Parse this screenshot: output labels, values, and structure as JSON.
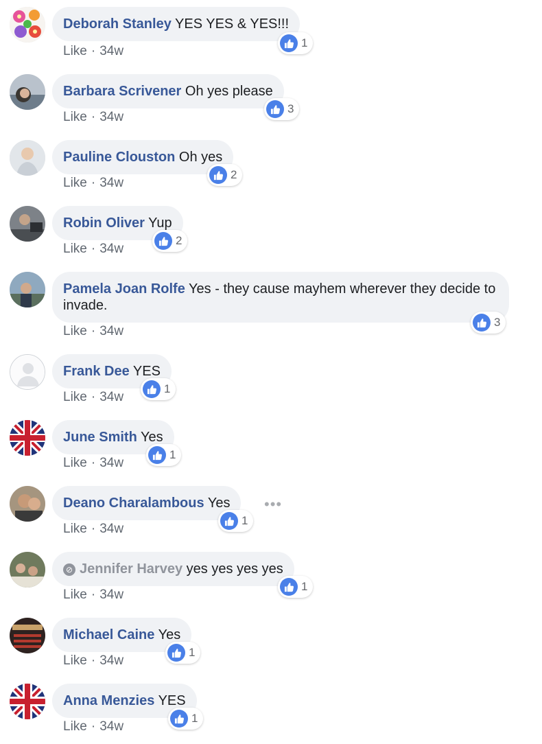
{
  "comments": [
    {
      "name": "Deborah Stanley",
      "text": "YES YES & YES!!!",
      "like_label": "Like",
      "separator": "·",
      "time": "34w",
      "reaction_count": "1"
    },
    {
      "name": "Barbara Scrivener",
      "text": "Oh yes please",
      "like_label": "Like",
      "separator": "·",
      "time": "34w",
      "reaction_count": "3"
    },
    {
      "name": "Pauline Clouston",
      "text": "Oh yes",
      "like_label": "Like",
      "separator": "·",
      "time": "34w",
      "reaction_count": "2"
    },
    {
      "name": "Robin Oliver",
      "text": "Yup",
      "like_label": "Like",
      "separator": "·",
      "time": "34w",
      "reaction_count": "2"
    },
    {
      "name": "Pamela Joan Rolfe",
      "text": "Yes - they cause mayhem wherever they decide to invade.",
      "like_label": "Like",
      "separator": "·",
      "time": "34w",
      "reaction_count": "3"
    },
    {
      "name": "Frank Dee",
      "text": "YES",
      "like_label": "Like",
      "separator": "·",
      "time": "34w",
      "reaction_count": "1"
    },
    {
      "name": "June Smith",
      "text": "Yes",
      "like_label": "Like",
      "separator": "·",
      "time": "34w",
      "reaction_count": "1"
    },
    {
      "name": "Deano Charalambous",
      "text": "Yes",
      "like_label": "Like",
      "separator": "·",
      "time": "34w",
      "reaction_count": "1",
      "more_label": "•••"
    },
    {
      "name": "Jennifer Harvey",
      "text": "yes yes yes yes",
      "like_label": "Like",
      "separator": "·",
      "time": "34w",
      "reaction_count": "1"
    },
    {
      "name": "Michael Caine",
      "text": "Yes",
      "like_label": "Like",
      "separator": "·",
      "time": "34w",
      "reaction_count": "1"
    },
    {
      "name": "Anna Menzies",
      "text": "YES",
      "like_label": "Like",
      "separator": "·",
      "time": "34w",
      "reaction_count": "1"
    }
  ],
  "colors": {
    "name_link": "#385898",
    "bubble_bg": "#f0f2f5",
    "like_blue": "#4a80e8",
    "meta_gray": "#606770"
  },
  "icons": {
    "reaction": "thumbs-up-icon",
    "deleted_account": "deleted-account-icon",
    "more": "more-options-icon"
  }
}
